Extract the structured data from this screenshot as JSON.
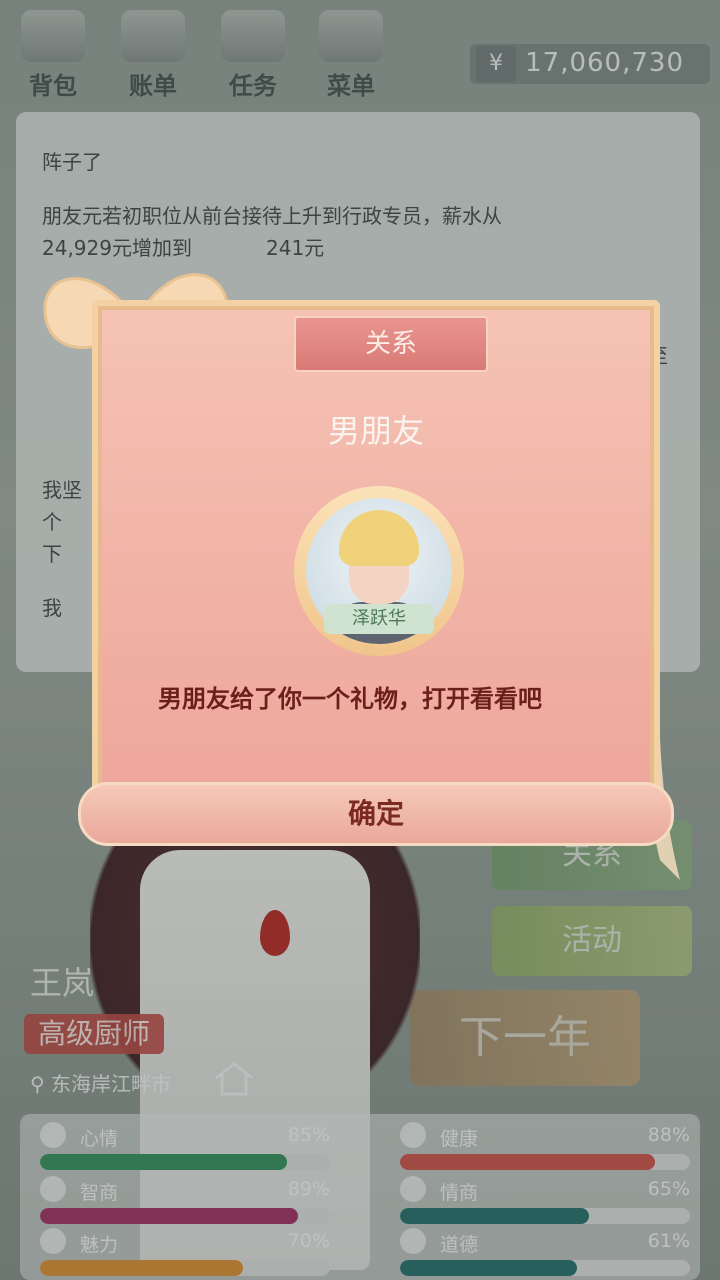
{
  "top_bar": {
    "buttons": [
      {
        "label": "背包"
      },
      {
        "label": "账单"
      },
      {
        "label": "任务"
      },
      {
        "label": "菜单"
      }
    ],
    "money": {
      "currency_symbol": "¥",
      "amount": "17,060,730"
    }
  },
  "event_log": {
    "lines": [
      "阵子了",
      "朋友元若初职位从前台接待上升到行政专员，薪水从",
      "24,929元增加到",
      "241元",
      "我坚",
      "个",
      "下",
      "我",
      "至"
    ]
  },
  "side_menu": {
    "relations_label": "关系",
    "activity_label": "活动",
    "next_year_label": "下一年"
  },
  "player": {
    "name": "王岚",
    "title": "高级厨师",
    "location": "东海岸江畔市"
  },
  "stats": [
    {
      "label": "心情",
      "value": "85%",
      "fraction": 0.85,
      "color": "#2e8b57",
      "icon": "smile-icon"
    },
    {
      "label": "健康",
      "value": "88%",
      "fraction": 0.88,
      "color": "#c84d45",
      "icon": "heart-icon"
    },
    {
      "label": "智商",
      "value": "89%",
      "fraction": 0.89,
      "color": "#9c2a5c",
      "icon": "bulb-icon"
    },
    {
      "label": "情商",
      "value": "65%",
      "fraction": 0.65,
      "color": "#1f6a66",
      "icon": "apple-icon"
    },
    {
      "label": "魅力",
      "value": "70%",
      "fraction": 0.7,
      "color": "#d58a2c",
      "icon": "sparkle-icon"
    },
    {
      "label": "道德",
      "value": "61%",
      "fraction": 0.61,
      "color": "#1f6a66",
      "icon": "scale-icon"
    }
  ],
  "dialog": {
    "tab_label": "关系",
    "relation": "男朋友",
    "avatar_name": "泽跃华",
    "message": "男朋友给了你一个礼物，打开看看吧",
    "confirm_label": "确定"
  }
}
